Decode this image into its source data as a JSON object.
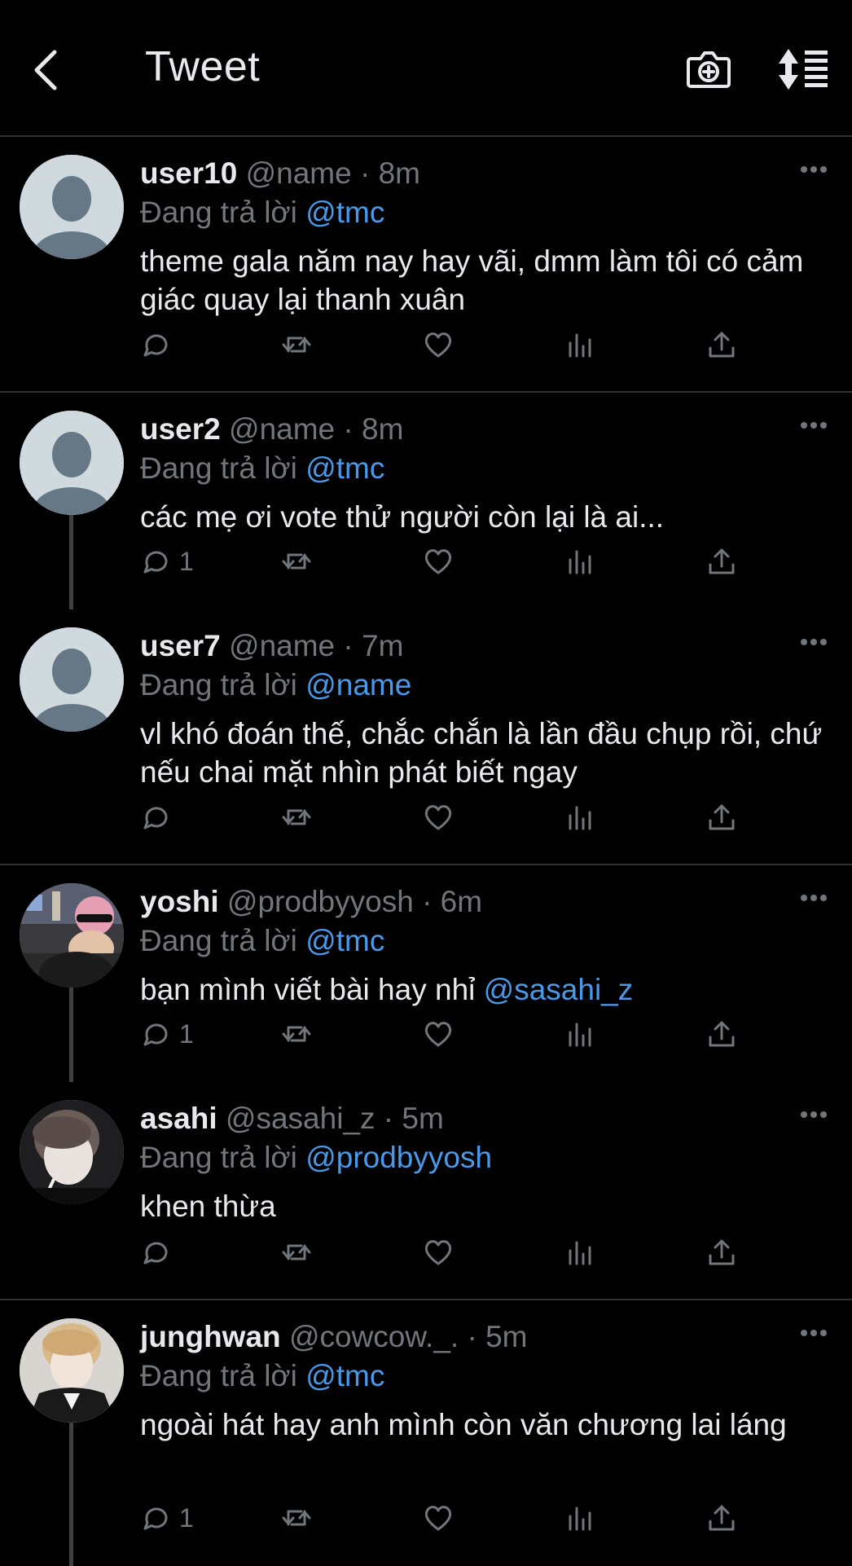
{
  "header": {
    "title": "Tweet"
  },
  "reply_prefix": "Đang trả lời",
  "tweets": [
    {
      "username": "user10",
      "handle": "@name",
      "separator": "·",
      "time": "8m",
      "reply_to": "@tmc",
      "text": "theme gala năm nay hay vãi, dmm làm tôi có cảm giác quay lại thanh xuân",
      "reply_count": ""
    },
    {
      "username": "user2",
      "handle": "@name",
      "separator": "·",
      "time": "8m",
      "reply_to": "@tmc",
      "text": "các mẹ ơi vote thử người còn lại là ai...",
      "reply_count": "1"
    },
    {
      "username": "user7",
      "handle": "@name",
      "separator": "·",
      "time": "7m",
      "reply_to": "@name",
      "text": "vl khó đoán thế, chắc chắn là lần đầu chụp rồi, chứ nếu chai mặt nhìn phát biết ngay",
      "reply_count": ""
    },
    {
      "username": "yoshi",
      "handle": "@prodbyyosh",
      "separator": "·",
      "time": "6m",
      "reply_to": "@tmc",
      "text": "bạn mình viết bài hay nhỉ ",
      "text_mention": "@sasahi_z",
      "reply_count": "1"
    },
    {
      "username": "asahi",
      "handle": "@sasahi_z",
      "separator": "·",
      "time": "5m",
      "reply_to": "@prodbyyosh",
      "text": "khen thừa",
      "reply_count": ""
    },
    {
      "username": "junghwan",
      "handle": "@cowcow._.",
      "separator": "·",
      "time": "5m",
      "reply_to": "@tmc",
      "text": "ngoài hát hay anh mình còn văn chương lai láng",
      "reply_count": "1"
    }
  ],
  "colors": {
    "background": "#000000",
    "text": "#e7e9ea",
    "muted": "#71767b",
    "mention": "#4a99e9",
    "divider": "#2f3336"
  }
}
